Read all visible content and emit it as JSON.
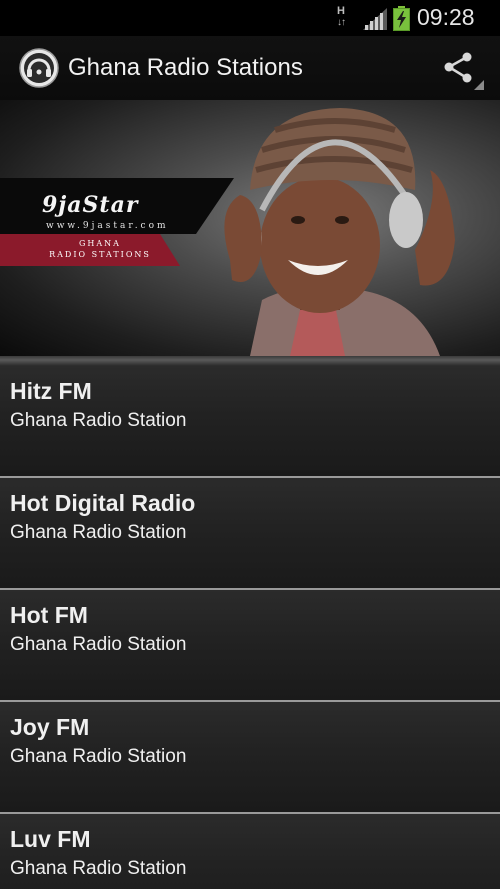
{
  "status_bar": {
    "network_type": "H",
    "network_arrows": "↓↑",
    "time": "09:28",
    "battery_icon": "battery-charging-icon",
    "signal_icon": "signal-icon"
  },
  "app_bar": {
    "title": "Ghana Radio Stations",
    "logo_icon": "radio-headphones-logo-icon",
    "share_icon": "share-icon"
  },
  "banner": {
    "brand": "9jaStar",
    "url": "www.9jastar.com",
    "tag_line1": "GHANA",
    "tag_line2": "RADIO STATIONS",
    "accent_color": "#8b1a2b"
  },
  "stations": [
    {
      "name": "Hitz FM",
      "subtitle": "Ghana Radio Station"
    },
    {
      "name": "Hot Digital Radio",
      "subtitle": "Ghana Radio Station"
    },
    {
      "name": "Hot FM",
      "subtitle": "Ghana Radio Station"
    },
    {
      "name": "Joy FM",
      "subtitle": "Ghana Radio Station"
    },
    {
      "name": "Luv FM",
      "subtitle": "Ghana Radio Station"
    }
  ]
}
